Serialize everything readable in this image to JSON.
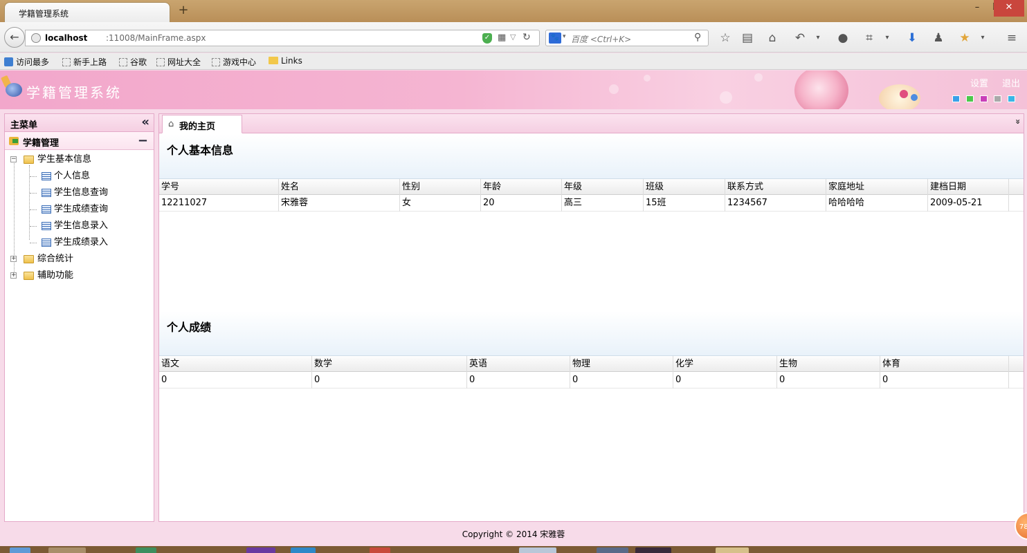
{
  "browser": {
    "tab_title": "学籍管理系统",
    "new_tab": "+",
    "window_min": "–",
    "window_max": "❐",
    "window_close": "✕",
    "back": "←",
    "url_host": "localhost",
    "url_path": ":11008/MainFrame.aspx",
    "search_engine_glyph": "🐾",
    "search_placeholder": "百度 <Ctrl+K>",
    "toolbar_icons": [
      "star-icon",
      "reading-list-icon",
      "home-icon",
      "undo-icon",
      "chat-icon",
      "crop-icon",
      "download-icon",
      "user-icon",
      "addon-icon",
      "menu-icon"
    ],
    "bookmarks": [
      "访问最多",
      "新手上路",
      "谷歌",
      "网址大全",
      "游戏中心",
      "Links"
    ]
  },
  "app": {
    "title": "学籍管理系统",
    "settings_label": "设置",
    "logout_label": "退出",
    "theme_swatches": [
      "#3aa0e8",
      "#4bc84b",
      "#c93fb8",
      "#a9a9a9",
      "#39b6e6"
    ]
  },
  "sidebar": {
    "title": "主菜单",
    "collapse_glyph": "«",
    "accordion_title": "学籍管理",
    "accordion_toggle": "−",
    "tree": {
      "root_label": "学生基本信息",
      "children": [
        "个人信息",
        "学生信息查询",
        "学生成绩查询",
        "学生信息录入",
        "学生成绩录入"
      ],
      "others": [
        "综合统计",
        "辅助功能"
      ]
    }
  },
  "main": {
    "tab_label": "我的主页",
    "tabs_more_glyph": "»",
    "info_section": {
      "title": "个人基本信息",
      "columns": [
        "学号",
        "姓名",
        "性别",
        "年龄",
        "年级",
        "班级",
        "联系方式",
        "家庭地址",
        "建档日期"
      ],
      "row": [
        "12211027",
        "宋雅蓉",
        "女",
        "20",
        "高三",
        "15班",
        "1234567",
        "哈哈哈哈",
        "2009-05-21"
      ]
    },
    "score_section": {
      "title": "个人成绩",
      "columns": [
        "语文",
        "数学",
        "英语",
        "物理",
        "化学",
        "生物",
        "体育"
      ],
      "row": [
        "0",
        "0",
        "0",
        "0",
        "0",
        "0",
        "0"
      ]
    }
  },
  "footer": {
    "copyright": "Copyright © 2014 宋雅蓉",
    "badge": "78"
  }
}
